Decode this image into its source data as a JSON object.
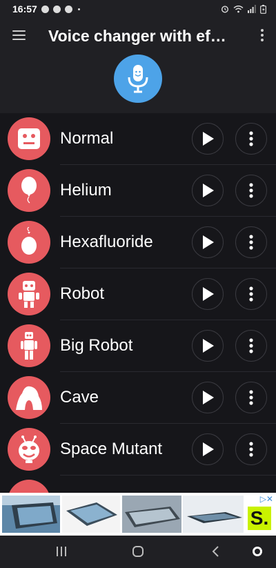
{
  "status_bar": {
    "time": "16:57",
    "left_icons": [
      "messenger-icon",
      "reddit-icon",
      "spotify-icon",
      "dot-icon"
    ],
    "right_icons": [
      "alarm-icon",
      "wifi-icon",
      "signal-icon",
      "battery-icon"
    ]
  },
  "appbar": {
    "title": "Voice changer with ef…",
    "menu_icon": "hamburger-icon",
    "overflow_icon": "kebab-icon"
  },
  "mic": {
    "icon": "microphone-icon",
    "color": "#4da3e8"
  },
  "effects": [
    {
      "label": "Normal",
      "icon": "normal-face-icon"
    },
    {
      "label": "Helium",
      "icon": "balloon-icon"
    },
    {
      "label": "Hexafluoride",
      "icon": "heavy-balloon-icon"
    },
    {
      "label": "Robot",
      "icon": "robot-icon"
    },
    {
      "label": "Big Robot",
      "icon": "big-robot-icon"
    },
    {
      "label": "Cave",
      "icon": "cave-icon"
    },
    {
      "label": "Space Mutant",
      "icon": "alien-icon"
    }
  ],
  "colors": {
    "accent": "#e65a5f",
    "background": "#16161a",
    "bar": "#202024"
  },
  "ad": {
    "logo_text": "S."
  },
  "navbar": {
    "buttons": [
      "recents-icon",
      "home-icon",
      "back-icon",
      "assistant-icon"
    ]
  }
}
